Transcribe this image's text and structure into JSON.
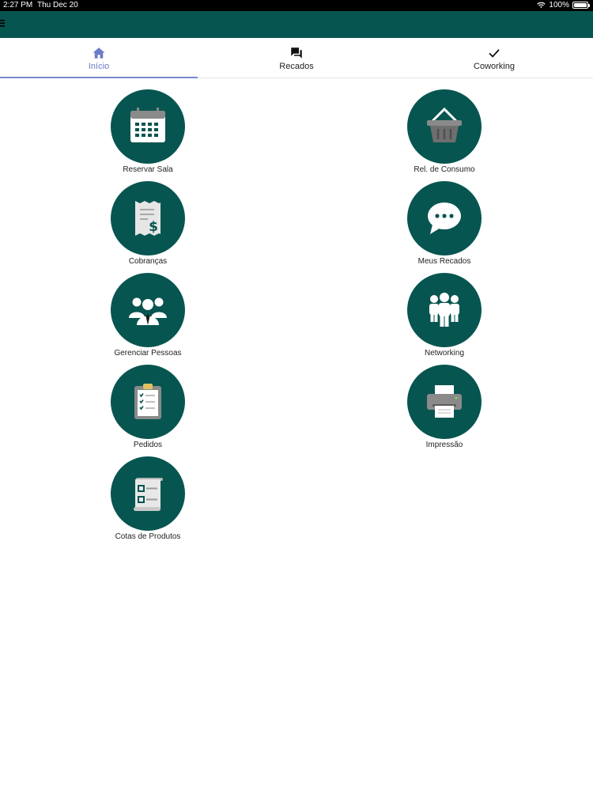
{
  "status_bar": {
    "time": "2:27 PM",
    "date": "Thu Dec 20",
    "battery": "100%",
    "wifi_icon": "wifi-icon",
    "battery_icon": "battery-icon"
  },
  "header": {
    "menu_icon": "menu-icon",
    "color": "#075550"
  },
  "tabs": [
    {
      "label": "Início",
      "icon": "home-icon",
      "active": true
    },
    {
      "label": "Recados",
      "icon": "chat-icon",
      "active": false
    },
    {
      "label": "Coworking",
      "icon": "check-icon",
      "active": false
    }
  ],
  "tiles": [
    {
      "label": "Reservar Sala",
      "icon": "calendar-icon"
    },
    {
      "label": "Rel. de Consumo",
      "icon": "basket-icon"
    },
    {
      "label": "Cobranças",
      "icon": "receipt-dollar-icon"
    },
    {
      "label": "Meus Recados",
      "icon": "speech-bubble-icon"
    },
    {
      "label": "Gerenciar Pessoas",
      "icon": "people-group-icon"
    },
    {
      "label": "Networking",
      "icon": "networking-people-icon"
    },
    {
      "label": "Pedidos",
      "icon": "clipboard-checklist-icon"
    },
    {
      "label": "Impressão",
      "icon": "printer-icon"
    },
    {
      "label": "Cotas de Produtos",
      "icon": "product-quota-list-icon"
    }
  ],
  "colors": {
    "primary": "#075550",
    "active_tab": "#6b7cc9"
  }
}
